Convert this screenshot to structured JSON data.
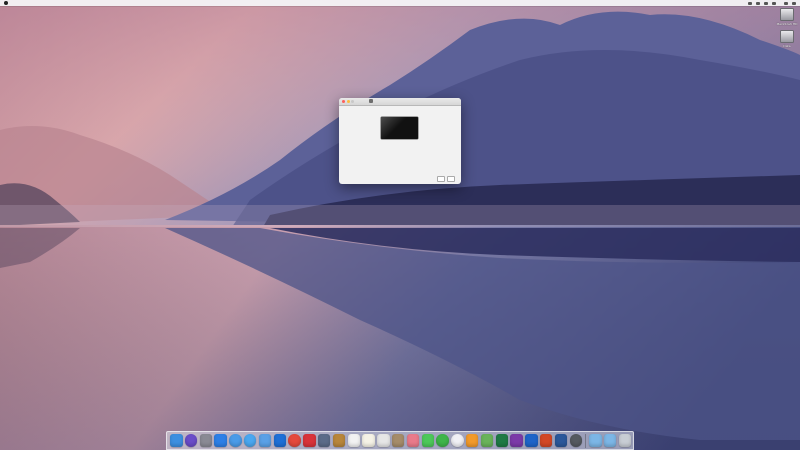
{
  "menubar": {
    "app_name": "",
    "items": [
      "",
      "",
      "",
      "",
      "",
      ""
    ],
    "status_items": [
      "",
      "",
      "",
      "",
      "",
      "",
      ""
    ],
    "clock": ""
  },
  "desktop_icons": [
    {
      "label": "Macintosh HD",
      "icon": "hard-drive-icon"
    },
    {
      "label": "Data",
      "icon": "hard-drive-icon"
    }
  ],
  "dialog": {
    "tabs": [
      "",
      "",
      "",
      "",
      "",
      ""
    ],
    "active_tab_index": 1,
    "monitor_icon": "display-icon",
    "display_name": "",
    "info_lines": [
      "",
      ""
    ],
    "buttons": [
      "",
      ""
    ]
  },
  "dock": {
    "apps": [
      {
        "name": "finder",
        "color": "#3d8fe0"
      },
      {
        "name": "siri",
        "color": "#6a4cc8"
      },
      {
        "name": "launchpad",
        "color": "#8a8a94"
      },
      {
        "name": "app-store",
        "color": "#2d7fe6"
      },
      {
        "name": "network",
        "color": "#4a9be8"
      },
      {
        "name": "safari",
        "color": "#4aa7f0"
      },
      {
        "name": "mail",
        "color": "#5aa0e6"
      },
      {
        "name": "xcode",
        "color": "#1e6fd6"
      },
      {
        "name": "chrome",
        "color": "#e4493d"
      },
      {
        "name": "tv",
        "color": "#d8333a"
      },
      {
        "name": "system-prefs",
        "color": "#5b6b88"
      },
      {
        "name": "notes-book",
        "color": "#b8863a"
      },
      {
        "name": "calendar",
        "color": "#f2f2f2"
      },
      {
        "name": "notes",
        "color": "#f5f2e6"
      },
      {
        "name": "textedit",
        "color": "#e6e6e6"
      },
      {
        "name": "preview",
        "color": "#a58c6a"
      },
      {
        "name": "photos",
        "color": "#e97a8a"
      },
      {
        "name": "messages",
        "color": "#4dc85a"
      },
      {
        "name": "facetime",
        "color": "#3eb54a"
      },
      {
        "name": "itunes",
        "color": "#f0f0f5"
      },
      {
        "name": "books",
        "color": "#f29a2b"
      },
      {
        "name": "maps",
        "color": "#69b35a"
      },
      {
        "name": "excel",
        "color": "#1f7a45"
      },
      {
        "name": "onenote",
        "color": "#7b3aa8"
      },
      {
        "name": "outlook",
        "color": "#1e64c8"
      },
      {
        "name": "powerpoint",
        "color": "#d24726"
      },
      {
        "name": "word",
        "color": "#2b579a"
      },
      {
        "name": "activity-monitor",
        "color": "#555a60"
      },
      {
        "name": "downloads",
        "color": "#7cb6e6"
      },
      {
        "name": "folder",
        "color": "#7cb6e6"
      },
      {
        "name": "trash",
        "color": "#c8cdd4"
      }
    ]
  }
}
